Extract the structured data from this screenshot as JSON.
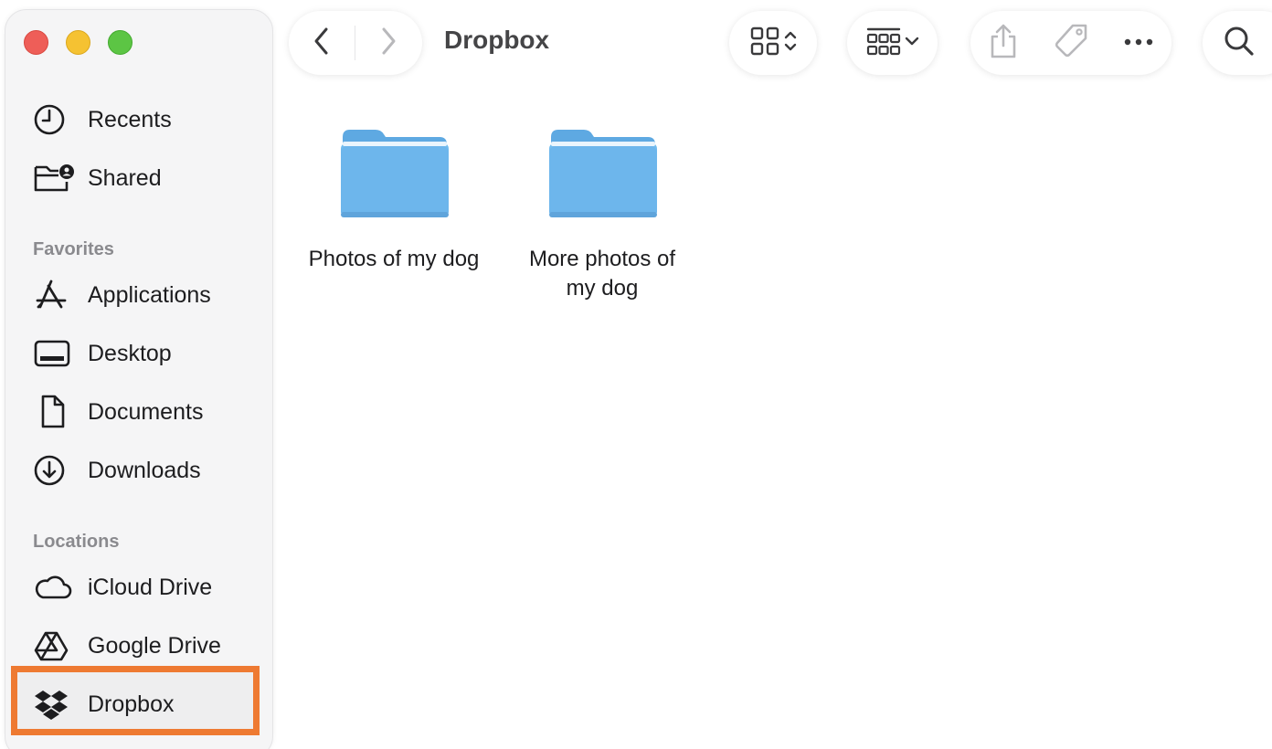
{
  "window": {
    "title": "Dropbox"
  },
  "sidebar": {
    "items_top": [
      {
        "label": "Recents",
        "icon": "clock-icon"
      },
      {
        "label": "Shared",
        "icon": "shared-folder-icon"
      }
    ],
    "favorites_heading": "Favorites",
    "favorites": [
      {
        "label": "Applications",
        "icon": "applications-icon"
      },
      {
        "label": "Desktop",
        "icon": "desktop-icon"
      },
      {
        "label": "Documents",
        "icon": "document-icon"
      },
      {
        "label": "Downloads",
        "icon": "download-icon"
      }
    ],
    "locations_heading": "Locations",
    "locations": [
      {
        "label": "iCloud Drive",
        "icon": "cloud-icon"
      },
      {
        "label": "Google Drive",
        "icon": "google-drive-icon"
      },
      {
        "label": "Dropbox",
        "icon": "dropbox-icon",
        "selected": true
      }
    ]
  },
  "content": {
    "folders": [
      {
        "name": "Photos of my dog",
        "icon": "folder-icon"
      },
      {
        "name": "More photos of my dog",
        "icon": "folder-icon"
      }
    ]
  },
  "colors": {
    "highlight_border": "#ee7a32",
    "folder_blue": "#6fbdee",
    "traffic_red": "#ee5e58",
    "traffic_yellow": "#f5c232",
    "traffic_green": "#5cc544"
  }
}
